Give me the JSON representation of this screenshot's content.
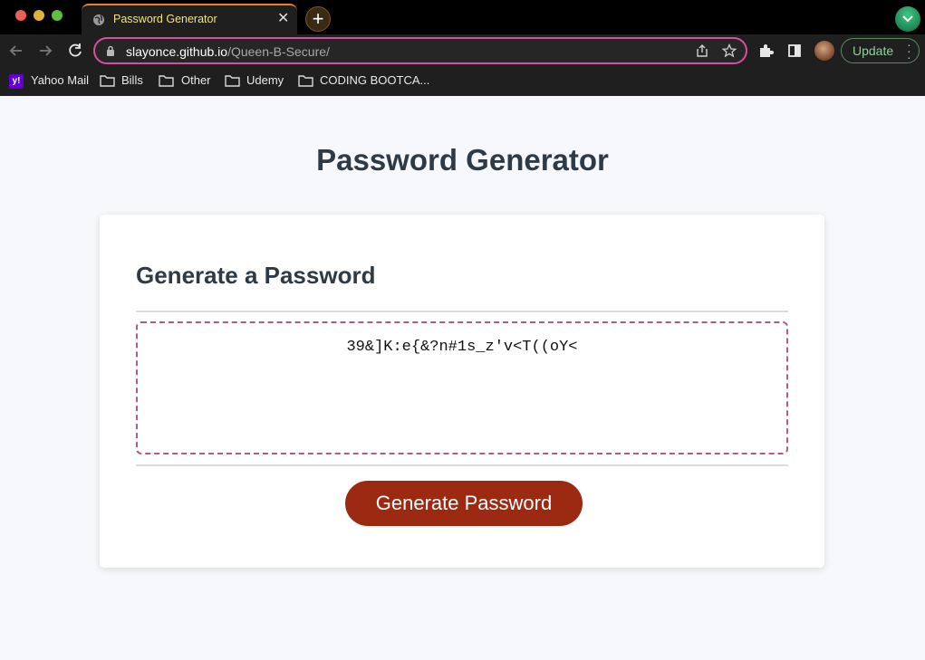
{
  "browser": {
    "tab": {
      "title": "Password Generator",
      "close_glyph": "✕",
      "icon": "globe-icon"
    },
    "new_tab_glyph": "+",
    "omnibox": {
      "domain": "slayonce.github.io",
      "path": "/Queen-B-Secure/"
    },
    "update_label": "Update",
    "bookmarks": [
      {
        "label": "Yahoo Mail",
        "icon": "yahoo-icon"
      },
      {
        "label": "Bills",
        "icon": "folder-icon"
      },
      {
        "label": "Other",
        "icon": "folder-icon"
      },
      {
        "label": "Udemy",
        "icon": "folder-icon"
      },
      {
        "label": "CODING BOOTCA...",
        "icon": "folder-icon"
      }
    ],
    "colors": {
      "omnibox_border": "#d94f9e",
      "tab_accent": "#e8813a",
      "update_text": "#8fd09b"
    }
  },
  "page": {
    "title": "Password Generator",
    "card": {
      "heading": "Generate a Password",
      "password": "39&]K:e{&?n#1s_z'v<T((oY<",
      "button_label": "Generate Password"
    },
    "colors": {
      "button": "#9c2a12",
      "text": "#2f3a47",
      "box_border": "#b05a8a"
    }
  }
}
